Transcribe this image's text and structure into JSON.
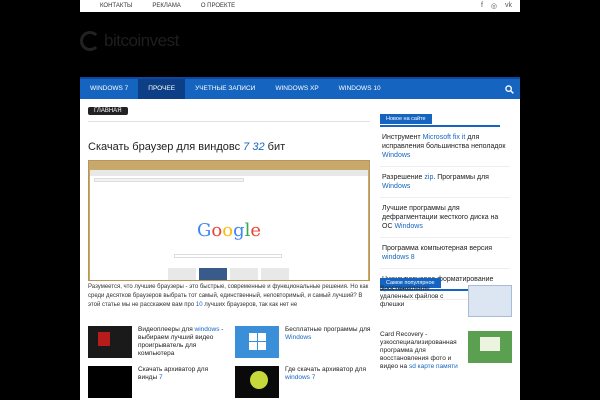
{
  "topbar": {
    "links": [
      "КОНТАКТЫ",
      "РЕКЛАМА",
      "О ПРОЕКТЕ"
    ],
    "social": [
      "f",
      "◎",
      "vk"
    ]
  },
  "logo": {
    "text": "bitcoinvest"
  },
  "nav": {
    "items": [
      "WINDOWS 7",
      "ПРОЧЕЕ",
      "УЧЕТНЫЕ ЗАПИСИ",
      "WINDOWS XP",
      "WINDOWS 10"
    ],
    "active_index": 1
  },
  "breadcrumb": "ГЛАВНАЯ",
  "article": {
    "title": "Скачать браузер для виндовс",
    "title_version": "7 32",
    "title_suffix": "бит",
    "desc_1": "Разумеется, что лучшие браузеры - это быстрые, современные и функциональные решения. Но как среди десятков браузеров выбрать тот самый, единственный, неповторимый, и самый лучший? В этой статье мы не расскажем вам про",
    "desc_num": "10",
    "desc_2": "лучших браузеров, так как нет не",
    "google": [
      "G",
      "o",
      "o",
      "g",
      "l",
      "e"
    ]
  },
  "related": [
    {
      "pre": "Видеоплееры для",
      "hl": "windows",
      "post": "- выбираем лучший видео проигрыватель для компьютера",
      "color": "#1a1a1a"
    },
    {
      "pre": "Бесплатные программы для",
      "hl": "Windows",
      "post": "",
      "color": "#3b8fd8"
    },
    {
      "pre": "Скачать архиватор для винды",
      "hl": "7",
      "post": "",
      "color": "#000000"
    },
    {
      "pre": "Где скачать архиватор для",
      "hl": "windows 7",
      "post": "",
      "color": "#0a0a0a"
    }
  ],
  "sidebar": {
    "new_head": "Новое на сайте",
    "new_items": [
      {
        "pre": "Инструмент",
        "hl": "Microsoft fix it",
        "post": "для исправления большинства неполадок",
        "hl2": "Windows"
      },
      {
        "pre": "Разрешение",
        "hl": "zip",
        "post": ". Программы для",
        "hl2": "Windows"
      },
      {
        "pre": "Лучшие программы для дефрагментации жесткого диска на ОС",
        "hl": "",
        "post": "",
        "hl2": "Windows"
      },
      {
        "pre": "Программа компьютерная версия",
        "hl": "",
        "post": "",
        "hl2": "windows 8"
      },
      {
        "pre": "Низкоуровневое форматирование флешки",
        "hl": "",
        "post": "",
        "hl2": ""
      }
    ],
    "pop_head": "Самое популярное",
    "pop_items": [
      {
        "pre": "Восстановление удаленных файлов с флешки",
        "hl": "",
        "color": "#dce6f2"
      },
      {
        "pre": "Card Recovery - узкоспециализированная программа для восстановления фото и видео на",
        "hl": "sd карте памяти",
        "color": "#5aa050"
      }
    ]
  }
}
